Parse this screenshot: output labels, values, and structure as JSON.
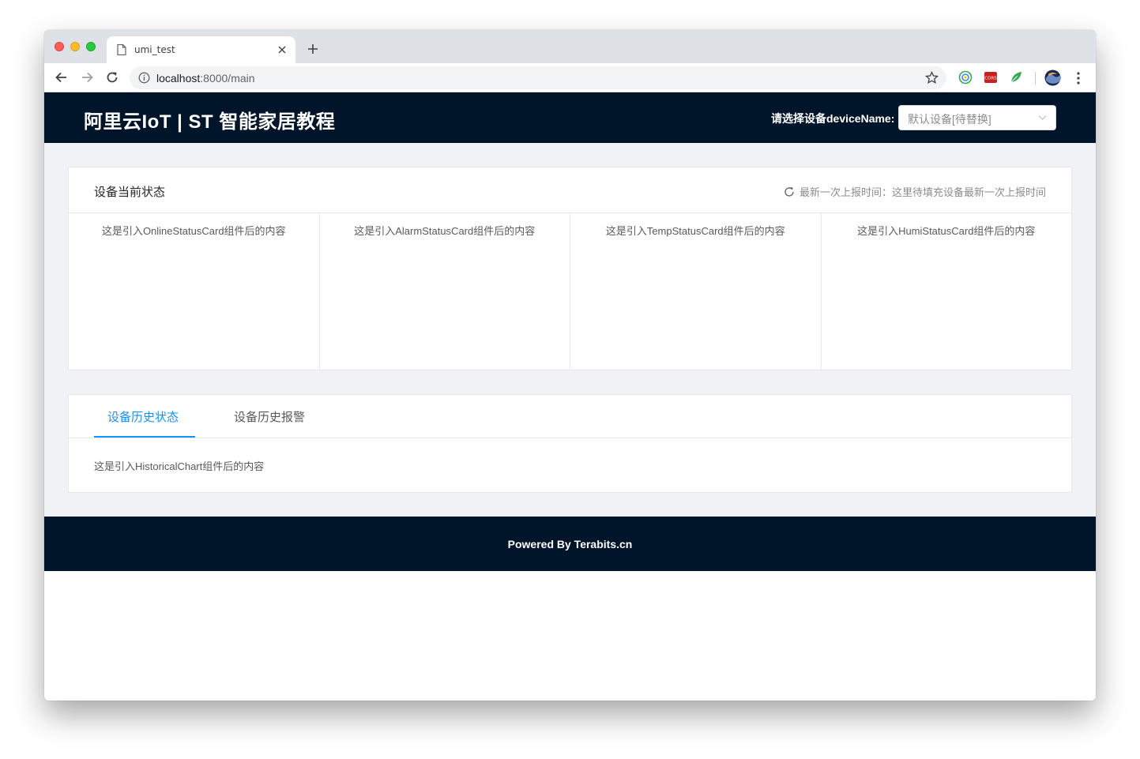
{
  "browser": {
    "tab_title": "umi_test",
    "url_host": "localhost",
    "url_path": ":8000/main",
    "ext_cors_label": "CORS"
  },
  "header": {
    "title": "阿里云IoT | ST 智能家居教程",
    "device_label": "请选择设备deviceName:",
    "device_select_value": "默认设备[待替换]"
  },
  "status_card": {
    "title": "设备当前状态",
    "last_report": "最新一次上报时间：这里待填充设备最新一次上报时间",
    "cells": [
      "这是引入OnlineStatusCard组件后的内容",
      "这是引入AlarmStatusCard组件后的内容",
      "这是引入TempStatusCard组件后的内容",
      "这是引入HumiStatusCard组件后的内容"
    ]
  },
  "history_card": {
    "tabs": [
      "设备历史状态",
      "设备历史报警"
    ],
    "active_tab": 0,
    "pane_text": "这是引入HistoricalChart组件后的内容"
  },
  "footer": {
    "text": "Powered By Terabits.cn"
  },
  "colors": {
    "header_bg": "#001529",
    "content_bg": "#f0f2f5",
    "accent": "#1890ff"
  },
  "icons": [
    "file-icon",
    "close-icon",
    "plus-icon",
    "back-arrow-icon",
    "forward-arrow-icon",
    "reload-icon",
    "info-icon",
    "star-icon",
    "kebab-menu-icon",
    "chevron-down-icon",
    "refresh-icon"
  ]
}
